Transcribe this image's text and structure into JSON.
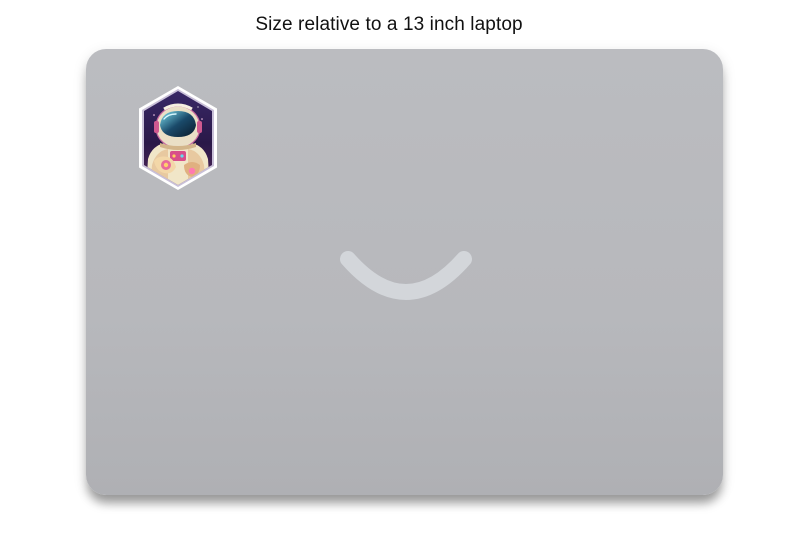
{
  "caption": "Size relative to a 13 inch laptop",
  "colors": {
    "laptop_lid": "#b8b9bd",
    "logo_smile": "#d3d6da",
    "sticker_border": "#ffffff",
    "sticker_background": "#2a1848",
    "sticker_accent": "#e05aa0"
  },
  "sticker": {
    "icon": "astronaut-icon"
  }
}
